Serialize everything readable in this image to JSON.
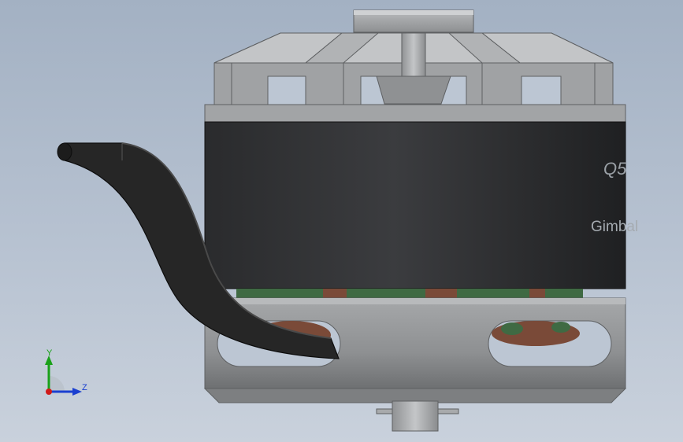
{
  "model": {
    "label_top": "Q5",
    "label_brand": "Gimbal"
  },
  "triad": {
    "y_axis": "Y",
    "z_axis": "Z"
  },
  "colors": {
    "background_top": "#a3b1c3",
    "background_bottom": "#c9d1dc",
    "metal": "#9fa1a3",
    "metal_dark": "#6f7173",
    "can": "#2b2c2e",
    "winding": "#7a4a38",
    "pcb": "#3f6a43",
    "cable": "#2a2a2a",
    "axis_y": "#1aa11a",
    "axis_z": "#1a3fd0",
    "axis_x": "#d01a1a"
  }
}
